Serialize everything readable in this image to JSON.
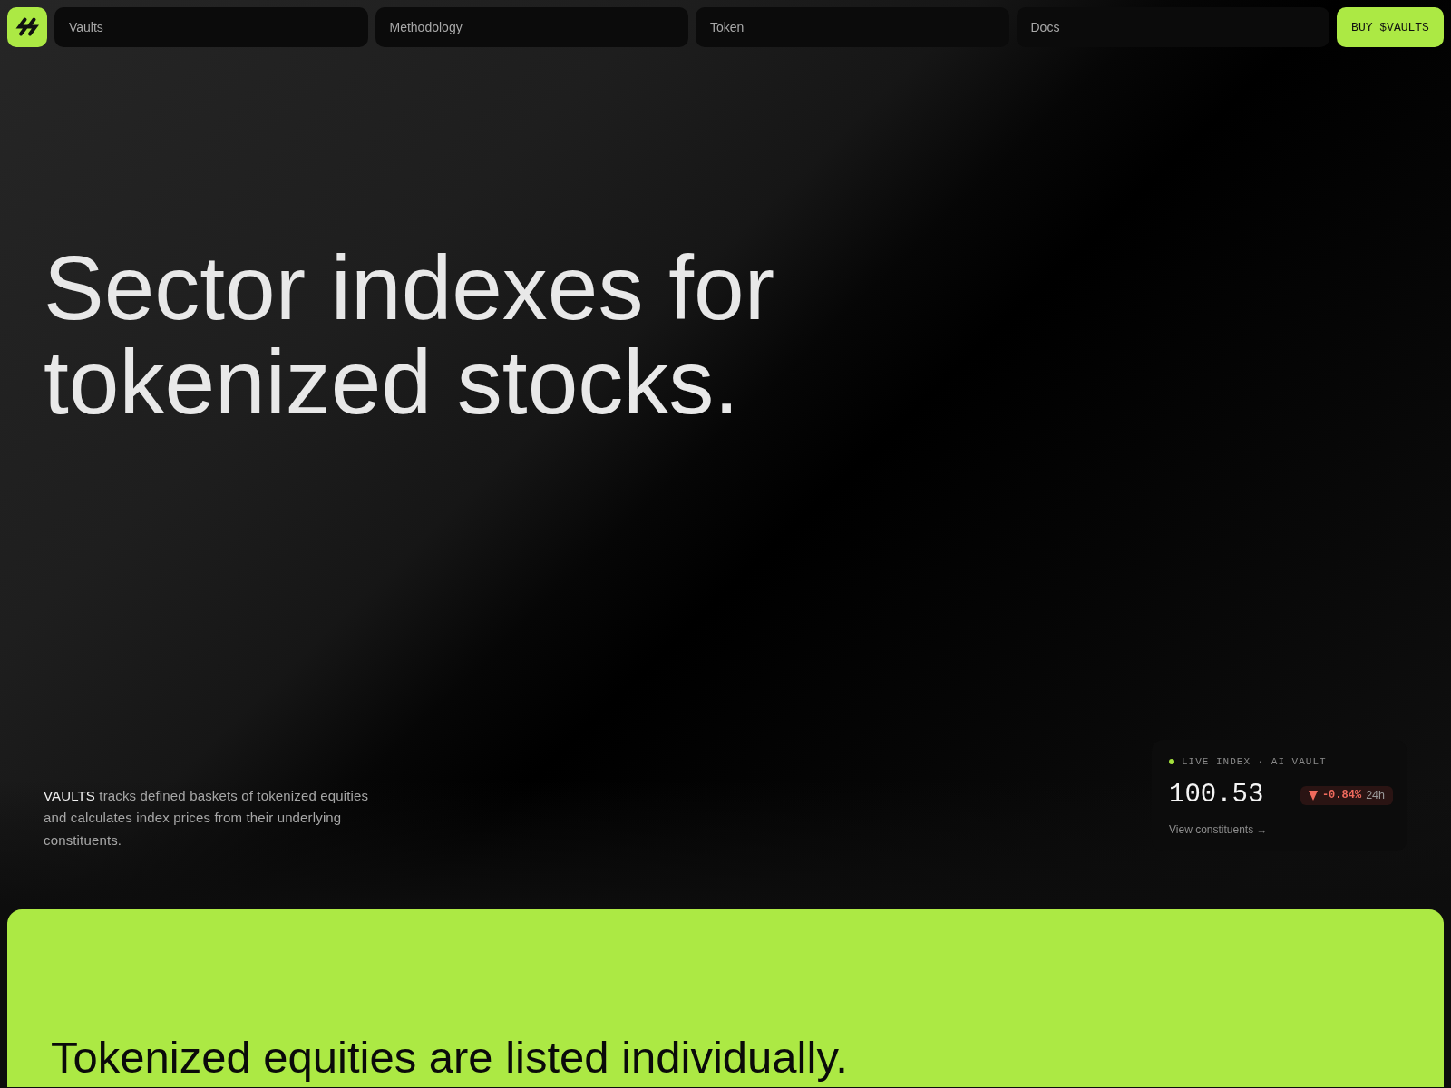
{
  "nav": {
    "links": [
      {
        "label": "Vaults"
      },
      {
        "label": "Methodology"
      },
      {
        "label": "Token"
      },
      {
        "label": "Docs"
      }
    ],
    "cta": {
      "label": "BUY $VAULTS"
    }
  },
  "hero": {
    "title": "Sector indexes for tokenized stocks.",
    "description": "**VAULTS** tracks defined baskets of tokenized equities and calculates index prices from their underlying constituents."
  },
  "index_card": {
    "label": "LIVE INDEX · AI VAULT",
    "value": "100.53",
    "negative": true,
    "change": "-0.84%",
    "period": "24h",
    "link": "View constituents →"
  },
  "section": {
    "title": "Tokenized equities are listed individually."
  }
}
